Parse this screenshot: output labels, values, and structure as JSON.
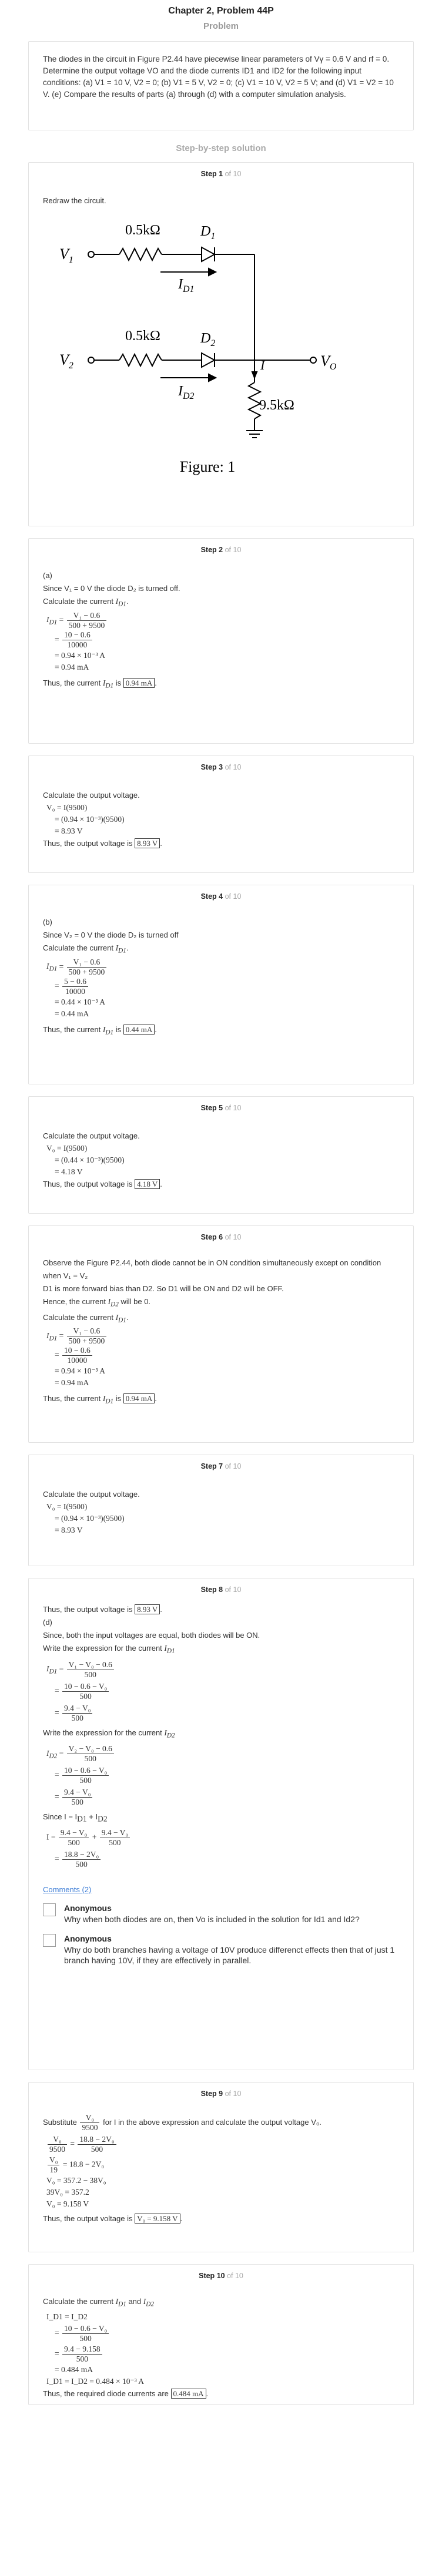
{
  "header": {
    "chapter_title": "Chapter 2, Problem 44P",
    "problem_heading": "Problem"
  },
  "problem": {
    "text": "The diodes in the circuit in Figure P2.44 have piecewise linear parameters of Vγ = 0.6 V and rf = 0. Determine the output voltage VO and the diode currents ID1 and ID2 for the following input conditions: (a) V1 = 10 V, V2 = 0; (b) V1 = 5 V, V2 = 0; (c) V1 = 10 V, V2 = 5 V; and (d) V1 = V2 = 10 V. (e) Compare the results of parts (a) through (d) with a computer simulation analysis."
  },
  "solution_heading": "Step-by-step solution",
  "step_label": "Step",
  "of_label": "of 10",
  "steps": [
    {
      "number": "1",
      "intro": "Redraw the circuit."
    },
    {
      "number": "2"
    },
    {
      "number": "3"
    },
    {
      "number": "4"
    },
    {
      "number": "5"
    },
    {
      "number": "6"
    },
    {
      "number": "7"
    },
    {
      "number": "8"
    },
    {
      "number": "9"
    },
    {
      "number": "10"
    }
  ],
  "circuit": {
    "v1": "V",
    "v1_sub": "1",
    "v2": "V",
    "v2_sub": "2",
    "r1": "0.5kΩ",
    "r2": "0.5kΩ",
    "d1": "D",
    "d1_sub": "1",
    "d2": "D",
    "d2_sub": "2",
    "id1": "I",
    "id1_sub": "D1",
    "id2": "I",
    "id2_sub": "D2",
    "i_label": "I",
    "vo": "V",
    "vo_sub": "O",
    "r3": "9.5kΩ",
    "caption": "Figure: 1"
  },
  "text": {
    "s2_part": "(a)",
    "s2_since": "Since V₁ = 0 V the diode D₂ is turned off.",
    "calc_current": "Calculate the current",
    "s2_eq1_num": "V₁ − 0.6",
    "s2_eq1_den": "500 + 9500",
    "s2_eq2_num": "10 − 0.6",
    "s2_eq2_den": "10000",
    "s2_eq3": "= 0.94 × 10⁻³ A",
    "s2_eq4": "= 0.94 mA",
    "thus_current": "Thus, the current",
    "is": "is",
    "ans_094ma": "0.94 mA",
    "calc_output": "Calculate the output voltage.",
    "s3_eq1": "V₀ = I(9500)",
    "s3_eq2": "= (0.94 × 10⁻³)(9500)",
    "s3_eq3": "= 8.93 V",
    "thus_output": "Thus, the output voltage is",
    "ans_893v": "8.93 V",
    "s4_part": "(b)",
    "s4_since": "Since V₂ = 0 V the diode D₂ is turned off",
    "s4_eq2_num": "5 − 0.6",
    "s4_eq3": "= 0.44 × 10⁻³ A",
    "s4_eq4": "= 0.44 mA",
    "ans_044ma": "0.44 mA",
    "s5_eq2": "= (0.44 × 10⁻³)(9500)",
    "s5_eq3": "= 4.18 V",
    "ans_418v": "4.18 V",
    "s6_l1": "Observe the Figure P2.44, both diode cannot be in ON condition simultaneously except on condition when V₁ = V₂",
    "s6_l2": "D1 is more forward bias than D2. So D1 will be ON and D2 will be OFF.",
    "s6_l3": "Hence, the current",
    "s6_l3b": "will be 0.",
    "s6_eq3": "= 0.94 × 10⁻³ A",
    "s6_eq4": "= 0.94 mA",
    "s8_l1": "Thus, the output voltage is",
    "s8_part": "(d)",
    "s8_l2": "Since, both the input voltages are equal, both diodes will be ON.",
    "s8_write": "Write the expression for the current",
    "s8_a_num": "V₁ − V₀ − 0.6",
    "s8_a_den": "500",
    "s8_b_num": "10 − 0.6 − V₀",
    "s8_c_num": "9.4 − V₀",
    "s8_d_num": "V₂ − V₀ − 0.6",
    "s8_since": "Since I = I",
    "s8_plus": "+ I",
    "s8_sum": "I =",
    "s8_res_num": "18.8 − 2V₀",
    "comments_link": "Comments (2)",
    "comments": [
      {
        "author": "Anonymous",
        "text": "Why when both diodes are on, then Vo is included in the solution for Id1 and Id2?"
      },
      {
        "author": "Anonymous",
        "text": "Why do both branches having a voltage of 10V produce differenct effects then that of just 1 branch having 10V, if they are effectively in parallel."
      }
    ],
    "s9_sub_a": "Substitute",
    "s9_sub_b": "for I in the above expression and calculate the output voltage V₀.",
    "s9_frac_num": "V₀",
    "s9_frac_den": "9500",
    "s9_e1_rhs_num": "18.8 − 2V₀",
    "s9_e1_rhs_den": "500",
    "s9_e2": "= 18.8 − 2V₀",
    "s9_e2_den": "19",
    "s9_e3": "V₀ = 357.2 − 38V₀",
    "s9_e4": "39V₀ = 357.2",
    "s9_e5": "V₀ = 9.158 V",
    "ans_9158": "V₀ = 9.158 V",
    "s10_calc": "Calculate the current",
    "s10_and": "and",
    "s10_e1": "I_D1 = I_D2",
    "s10_e2_num": "10 − 0.6 − V₀",
    "s10_e3_num": "9.4 − 9.158",
    "s10_e4": "= 0.484 mA",
    "s10_e5": "I_D1 = I_D2 = 0.484 × 10⁻³ A",
    "s10_thus": "Thus, the required diode currents are",
    "ans_0484": "0.484 mA"
  }
}
